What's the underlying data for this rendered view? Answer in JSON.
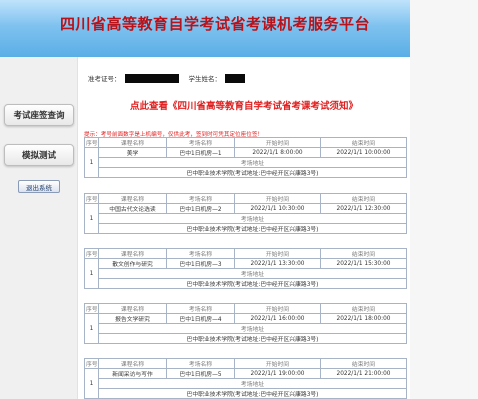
{
  "header": {
    "title": "四川省高等教育自学考试省考课机考服务平台"
  },
  "sidebar": {
    "seat_query": "考试座签查询",
    "mock_test": "模拟测试",
    "logout": "退出系统"
  },
  "info": {
    "ticket_label": "准考证号：",
    "name_label": "学生姓名："
  },
  "notice": "点此查看《四川省高等教育自学考试省考课考试须知》",
  "hint": "提示：考号前面数字是上机编号，仅供此考，签到时可凭其定位座位签！",
  "headers": {
    "seq": "序号",
    "course": "课程名称",
    "room": "考场名称",
    "start": "开始时间",
    "end": "结束时间",
    "addr_label": "考场地址"
  },
  "exams": [
    {
      "seq": "1",
      "course": "美学",
      "room": "巴中1日机房—1",
      "start": "2022/1/1 8:00:00",
      "end": "2022/1/1 10:00:00",
      "addr": "巴中职业技术学院(考试地址:巴中经开区兴康路3号)"
    },
    {
      "seq": "1",
      "course": "中国古代文论选读",
      "room": "巴中1日机房—2",
      "start": "2022/1/1 10:30:00",
      "end": "2022/1/1 12:30:00",
      "addr": "巴中职业技术学院(考试地址:巴中经开区兴康路3号)"
    },
    {
      "seq": "1",
      "course": "散文创作与研究",
      "room": "巴中1日机房—3",
      "start": "2022/1/1 13:30:00",
      "end": "2022/1/1 15:30:00",
      "addr": "巴中职业技术学院(考试地址:巴中经开区兴康路3号)"
    },
    {
      "seq": "1",
      "course": "报告文学研究",
      "room": "巴中1日机房—4",
      "start": "2022/1/1 16:00:00",
      "end": "2022/1/1 18:00:00",
      "addr": "巴中职业技术学院(考试地址:巴中经开区兴康路3号)"
    },
    {
      "seq": "1",
      "course": "新闻采访与写作",
      "room": "巴中1日机房—5",
      "start": "2022/1/1 19:00:00",
      "end": "2022/1/1 21:00:00",
      "addr": "巴中职业技术学院(考试地址:巴中经开区兴康路3号)"
    }
  ],
  "colors": {
    "title_red": "#b8121a",
    "notice_red": "#e02020",
    "table_border": "#a7b4c8",
    "header_blue": "#5aaee6"
  }
}
